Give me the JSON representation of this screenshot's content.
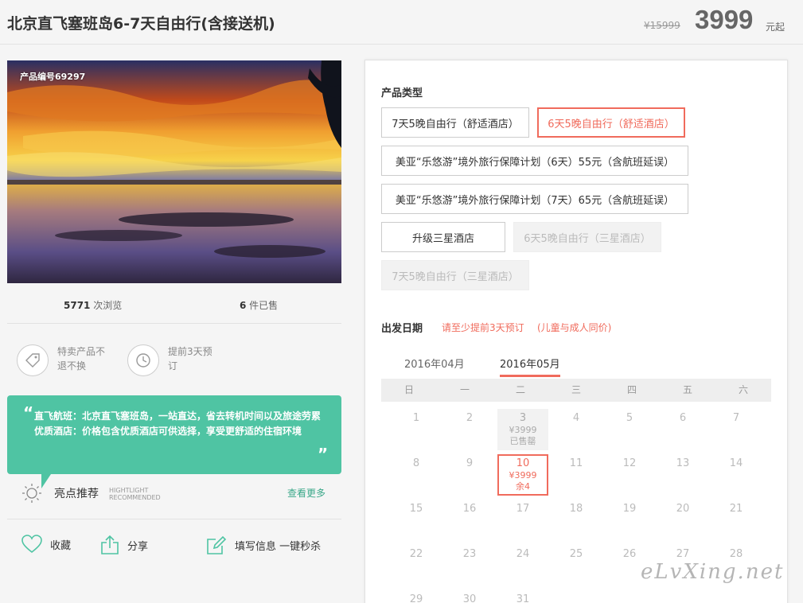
{
  "header": {
    "title": "北京直飞塞班岛6-7天自由行(含接送机)",
    "original_price": "¥15999",
    "price": "3999",
    "price_suffix": "元起"
  },
  "hero": {
    "code_label": "产品编号69297"
  },
  "stats": {
    "views_count": "5771",
    "views_label": " 次浏览",
    "sold_count": "6",
    "sold_label": " 件已售"
  },
  "features": [
    {
      "icon": "tag-icon",
      "line1": "特卖产品不",
      "line2": "退不换"
    },
    {
      "icon": "clock-icon",
      "line1": "提前3天预",
      "line2": "订"
    }
  ],
  "quote": {
    "open": "“",
    "close": "”",
    "line1": "直飞航班：北京直飞塞班岛，一站直达，省去转机时间以及旅途劳累",
    "line2": "优质酒店：价格包含优质酒店可供选择，享受更舒适的住宿环境"
  },
  "highlight": {
    "title": "亮点推荐",
    "en1": "HIGHTLIGHT",
    "en2": "RECOMMENDED",
    "more": "查看更多"
  },
  "actions": {
    "favorite": "收藏",
    "share": "分享",
    "fill_info": "填写信息 一键秒杀"
  },
  "product_type": {
    "label": "产品类型",
    "options": [
      {
        "label": "7天5晚自由行（舒适酒店）",
        "state": "normal"
      },
      {
        "label": "6天5晚自由行（舒适酒店）",
        "state": "selected"
      },
      {
        "label": "美亚“乐悠游”境外旅行保障计划（6天）55元（含航班延误）",
        "state": "normal"
      },
      {
        "label": "美亚“乐悠游”境外旅行保障计划（7天）65元（含航班延误）",
        "state": "normal"
      },
      {
        "label": "升级三星酒店",
        "state": "normal"
      },
      {
        "label": "6天5晚自由行（三星酒店）",
        "state": "disabled"
      },
      {
        "label": "7天5晚自由行（三星酒店）",
        "state": "disabled"
      }
    ]
  },
  "departure": {
    "label": "出发日期",
    "note1": "请至少提前3天预订",
    "note2": "(儿童与成人同价)",
    "months": [
      "2016年04月",
      "2016年05月"
    ],
    "active_month": "2016年05月",
    "weekdays": [
      "日",
      "一",
      "二",
      "三",
      "四",
      "五",
      "六"
    ],
    "days": {
      "1": "1",
      "2": "2",
      "4": "4",
      "5": "5",
      "6": "6",
      "7": "7",
      "8": "8",
      "9": "9",
      "11": "11",
      "12": "12",
      "13": "13",
      "14": "14",
      "15": "15",
      "16": "16",
      "17": "17",
      "18": "18",
      "19": "19",
      "20": "20",
      "21": "21",
      "22": "22",
      "23": "23",
      "24": "24",
      "25": "25",
      "26": "26",
      "27": "27",
      "28": "28",
      "29": "29",
      "30": "30",
      "31": "31"
    },
    "special": {
      "d3": {
        "day": "3",
        "price": "¥3999",
        "status": "已售罄"
      },
      "d10": {
        "day": "10",
        "price": "¥3999",
        "status": "余4"
      }
    }
  },
  "watermark": "eLvXing.net",
  "colors": {
    "accent": "#f06b5c",
    "teal": "#4fc4a3",
    "link_green": "#3aa889"
  }
}
